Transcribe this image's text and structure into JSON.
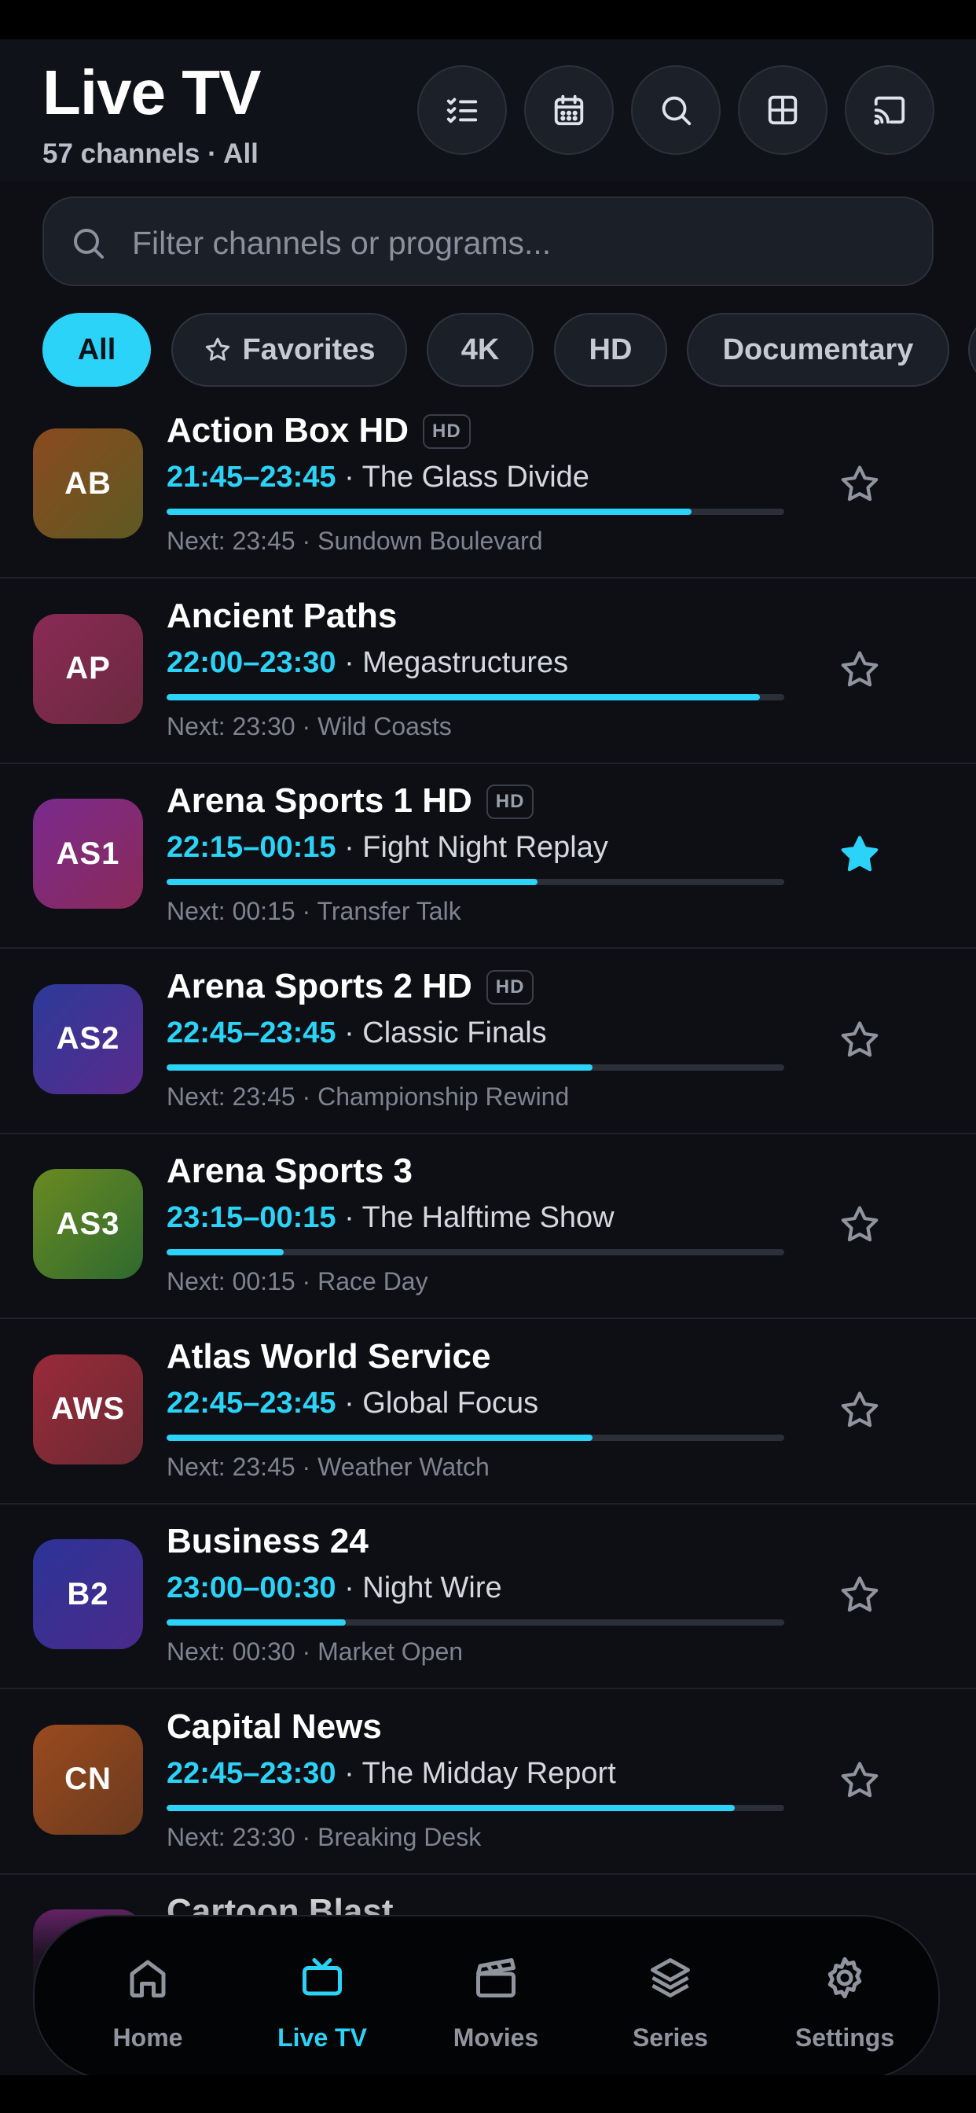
{
  "header": {
    "title": "Live TV",
    "subtitle": "57 channels · All",
    "buttons": [
      "checklist-icon",
      "calendar-icon",
      "search-icon",
      "grid-icon",
      "cast-icon"
    ]
  },
  "search": {
    "placeholder": "Filter channels or programs..."
  },
  "filters": [
    {
      "label": "All",
      "active": true
    },
    {
      "label": "Favorites",
      "icon": "star-icon"
    },
    {
      "label": "4K"
    },
    {
      "label": "HD"
    },
    {
      "label": "Documentary"
    }
  ],
  "channels": [
    {
      "logo_text": "AB",
      "name": "Action Box HD",
      "badge": "HD",
      "time": "21:45–23:45",
      "program": "· The Glass Divide",
      "progress": 0.85,
      "next": "Next: 23:45 · Sundown Boulevard",
      "favorite": false,
      "colors": [
        "#8a4a1f",
        "#5e5a22"
      ]
    },
    {
      "logo_text": "AP",
      "name": "Ancient Paths",
      "badge": "",
      "time": "22:00–23:30",
      "program": "· Megastructures",
      "progress": 0.96,
      "next": "Next: 23:30 · Wild Coasts",
      "favorite": false,
      "colors": [
        "#8a2a55",
        "#6a2a3e"
      ]
    },
    {
      "logo_text": "AS1",
      "name": "Arena Sports 1 HD",
      "badge": "HD",
      "time": "22:15–00:15",
      "program": "· Fight Night Replay",
      "progress": 0.6,
      "next": "Next: 00:15 · Transfer Talk",
      "favorite": true,
      "colors": [
        "#7a2a8e",
        "#8a2a58"
      ]
    },
    {
      "logo_text": "AS2",
      "name": "Arena Sports 2 HD",
      "badge": "HD",
      "time": "22:45–23:45",
      "program": "· Classic Finals",
      "progress": 0.69,
      "next": "Next: 23:45 · Championship Rewind",
      "favorite": false,
      "colors": [
        "#2c3a9a",
        "#5a2a8a"
      ]
    },
    {
      "logo_text": "AS3",
      "name": "Arena Sports 3",
      "badge": "",
      "time": "23:15–00:15",
      "program": "· The Halftime Show",
      "progress": 0.19,
      "next": "Next: 00:15 · Race Day",
      "favorite": false,
      "colors": [
        "#6a8a22",
        "#2e6a2e"
      ]
    },
    {
      "logo_text": "AWS",
      "name": "Atlas World Service",
      "badge": "",
      "time": "22:45–23:45",
      "program": "· Global Focus",
      "progress": 0.69,
      "next": "Next: 23:45 · Weather Watch",
      "favorite": false,
      "colors": [
        "#9a2a3a",
        "#6a2a32"
      ]
    },
    {
      "logo_text": "B2",
      "name": "Business 24",
      "badge": "",
      "time": "23:00–00:30",
      "program": "· Night Wire",
      "progress": 0.29,
      "next": "Next: 00:30 · Market Open",
      "favorite": false,
      "colors": [
        "#2c3498",
        "#4a2a8a"
      ]
    },
    {
      "logo_text": "CN",
      "name": "Capital News",
      "badge": "",
      "time": "22:45–23:30",
      "program": "· The Midday Report",
      "progress": 0.92,
      "next": "Next: 23:30 · Breaking Desk",
      "favorite": false,
      "colors": [
        "#9a4a1e",
        "#6a3a1e"
      ]
    },
    {
      "logo_text": "",
      "name": "Cartoon Blast",
      "badge": "",
      "time": "",
      "program": "",
      "progress": 0,
      "next": "",
      "favorite": false,
      "colors": [
        "#8a2a8a",
        "#6a2a6a"
      ]
    }
  ],
  "nav": [
    {
      "label": "Home",
      "icon": "home-icon",
      "active": false
    },
    {
      "label": "Live TV",
      "icon": "tv-icon",
      "active": true
    },
    {
      "label": "Movies",
      "icon": "clapperboard-icon",
      "active": false
    },
    {
      "label": "Series",
      "icon": "layers-icon",
      "active": false
    },
    {
      "label": "Settings",
      "icon": "gear-icon",
      "active": false
    }
  ],
  "colors": {
    "accent": "#2ad3f7",
    "background": "#0d0f14",
    "surface": "#1b1f28"
  }
}
